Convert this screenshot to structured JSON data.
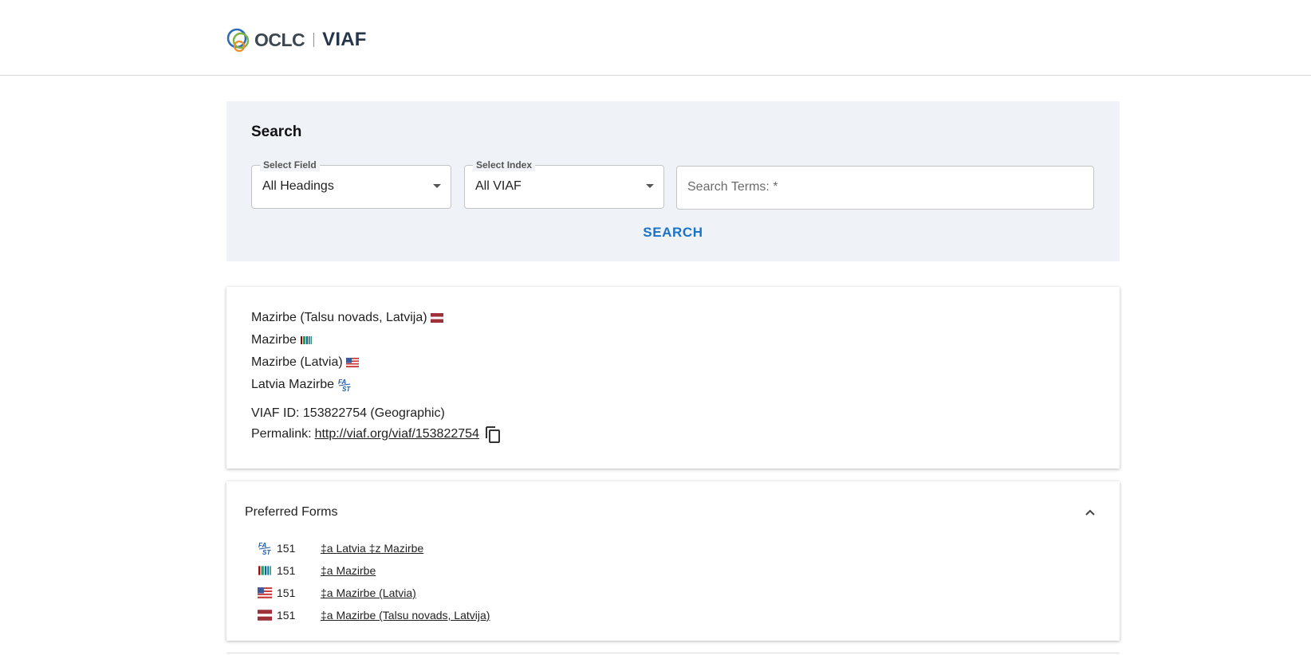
{
  "header": {
    "logo_oclc": "OCLC",
    "logo_viaf": "VIAF"
  },
  "search": {
    "heading": "Search",
    "field_label": "Select Field",
    "field_value": "All Headings",
    "index_label": "Select Index",
    "index_value": "All VIAF",
    "terms_placeholder": "Search Terms: *",
    "button_label": "SEARCH"
  },
  "record": {
    "headings": [
      {
        "text": "Mazirbe (Talsu novads, Latvija)",
        "source_icon": "latvia-flag-icon"
      },
      {
        "text": "Mazirbe",
        "source_icon": "wikidata-icon"
      },
      {
        "text": "Mazirbe (Latvia)",
        "source_icon": "us-flag-icon"
      },
      {
        "text": "Latvia Mazirbe",
        "source_icon": "fast-icon"
      }
    ],
    "viaf_id_line": "VIAF ID: 153822754 (Geographic)",
    "permalink_label": "Permalink:",
    "permalink_url": "http://viaf.org/viaf/153822754"
  },
  "preferred_forms": {
    "title": "Preferred Forms",
    "rows": [
      {
        "source_icon": "fast-icon",
        "tag": "151",
        "value": "‡a Latvia ‡z Mazirbe"
      },
      {
        "source_icon": "wikidata-icon",
        "tag": "151",
        "value": "‡a Mazirbe"
      },
      {
        "source_icon": "us-flag-icon",
        "tag": "151",
        "value": "‡a Mazirbe (Latvia)"
      },
      {
        "source_icon": "latvia-flag-icon",
        "tag": "151",
        "value": "‡a Mazirbe (Talsu novads, Latvija)"
      }
    ]
  },
  "colors": {
    "accent": "#1a73c8",
    "panel_bg": "#eff3f8",
    "latvia_red": "#9e3039"
  }
}
